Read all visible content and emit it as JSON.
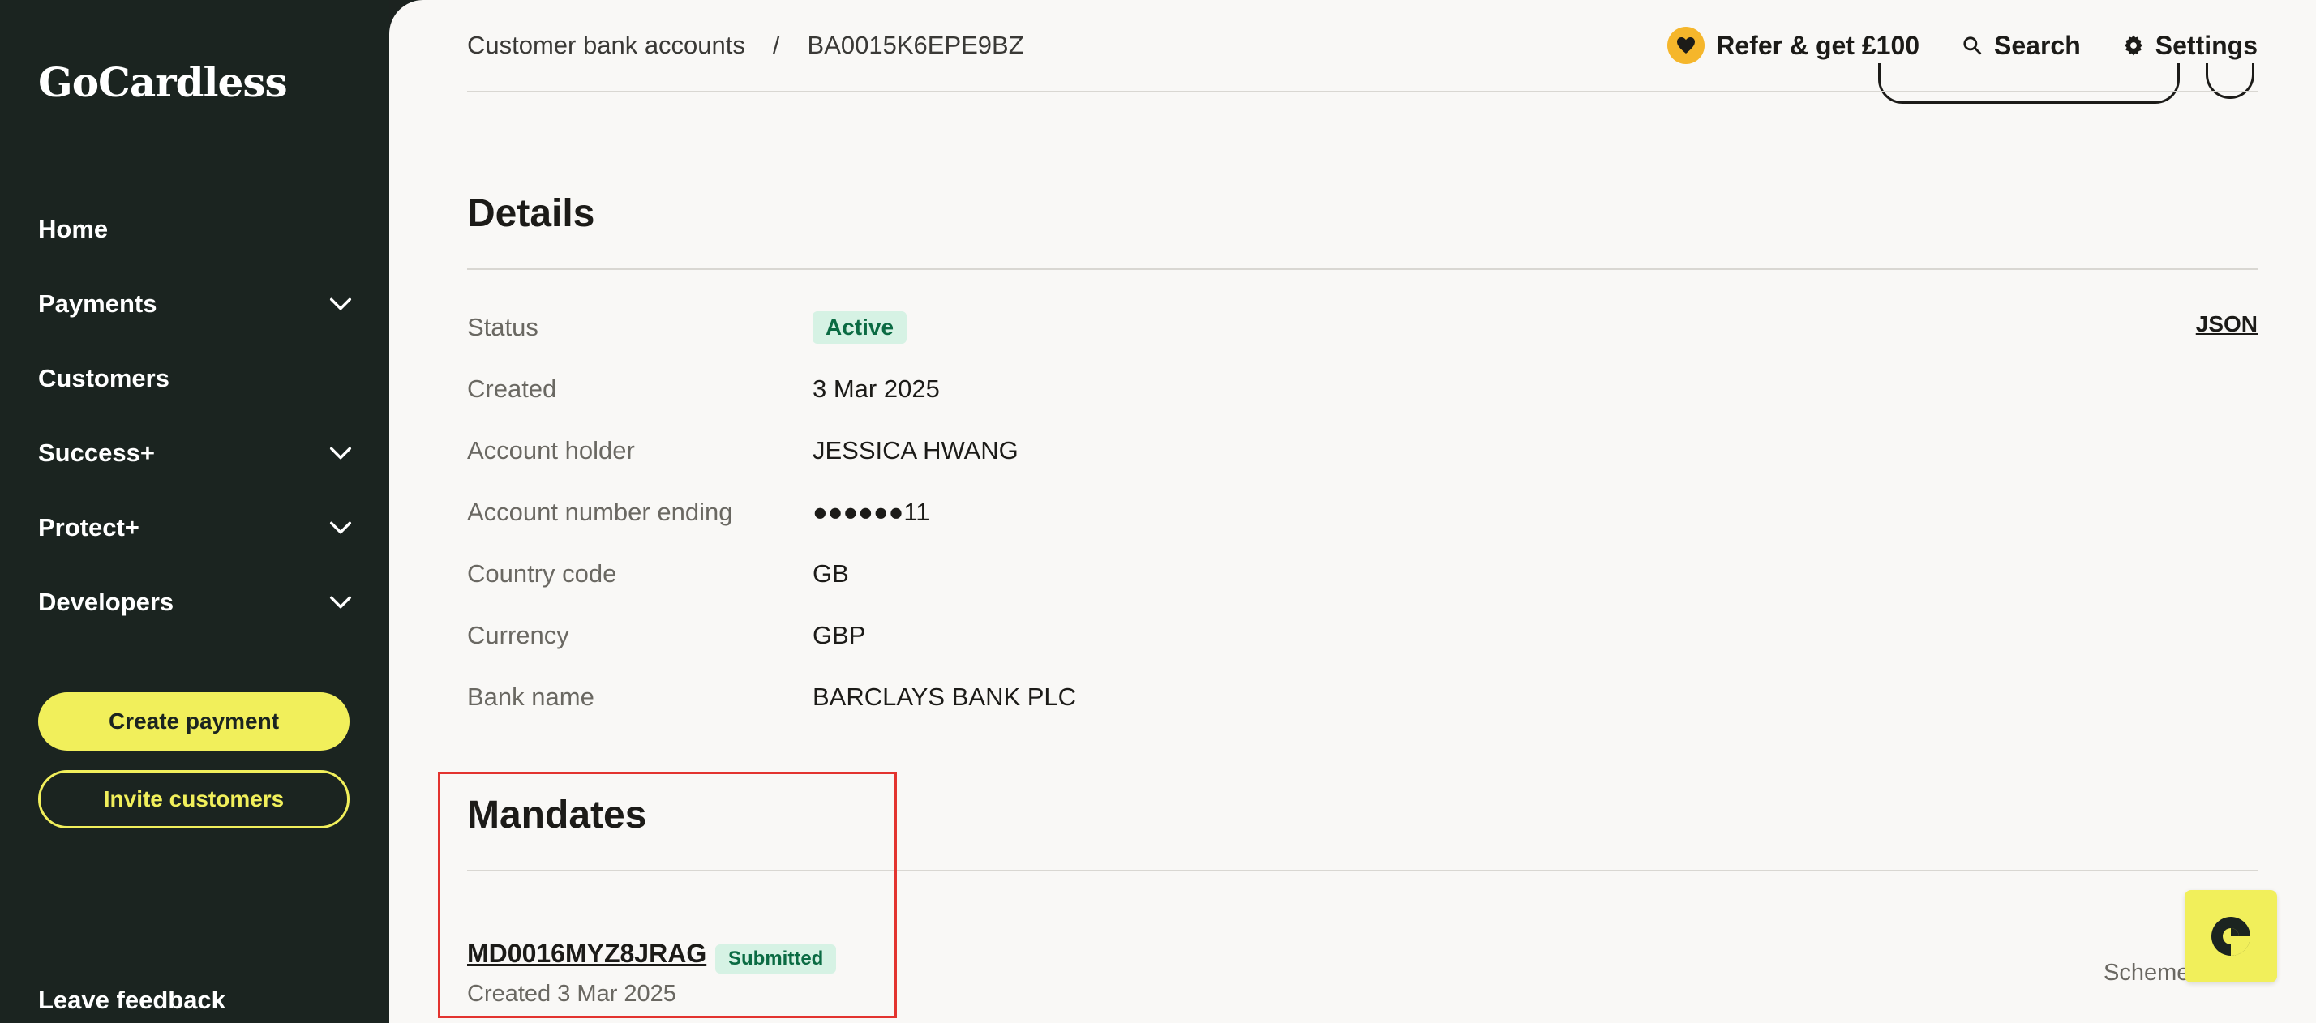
{
  "brand": {
    "logo_text": "GoCardless"
  },
  "sidebar": {
    "items": [
      {
        "label": "Home",
        "has_chevron": false
      },
      {
        "label": "Payments",
        "has_chevron": true
      },
      {
        "label": "Customers",
        "has_chevron": false
      },
      {
        "label": "Success+",
        "has_chevron": true
      },
      {
        "label": "Protect+",
        "has_chevron": true
      },
      {
        "label": "Developers",
        "has_chevron": true
      }
    ],
    "create_payment_label": "Create payment",
    "invite_customers_label": "Invite customers",
    "leave_feedback_label": "Leave feedback"
  },
  "header": {
    "breadcrumb_parent": "Customer bank accounts",
    "breadcrumb_separator": "/",
    "breadcrumb_current": "BA0015K6EPE9BZ",
    "refer_label": "Refer & get £100",
    "search_label": "Search",
    "settings_label": "Settings"
  },
  "details": {
    "title": "Details",
    "json_link": "JSON",
    "rows": [
      {
        "label": "Status",
        "value": "Active"
      },
      {
        "label": "Created",
        "value": "3 Mar 2025"
      },
      {
        "label": "Account holder",
        "value": "JESSICA HWANG"
      },
      {
        "label": "Account number ending",
        "value": "●●●●●●11"
      },
      {
        "label": "Country code",
        "value": "GB"
      },
      {
        "label": "Currency",
        "value": "GBP"
      },
      {
        "label": "Bank name",
        "value": "BARCLAYS BANK PLC"
      }
    ]
  },
  "mandates": {
    "title": "Mandates",
    "items": [
      {
        "id": "MD0016MYZ8JRAG",
        "status": "Submitted",
        "created": "Created 3 Mar 2025",
        "scheme_label": "Scheme"
      }
    ]
  },
  "colors": {
    "sidebar_bg": "#1b2420",
    "accent_yellow": "#f1ef5b",
    "main_bg": "#f9f8f6",
    "badge_green_bg": "#d6f2e4",
    "badge_green_text": "#0b6b43",
    "highlight_red": "#e3342f",
    "heart_orange": "#f5b62b"
  },
  "icons": {
    "chevron": "chevron-down-icon",
    "heart": "heart-icon",
    "search": "search-icon",
    "settings": "gear-icon",
    "help": "gocardless-help-icon"
  }
}
